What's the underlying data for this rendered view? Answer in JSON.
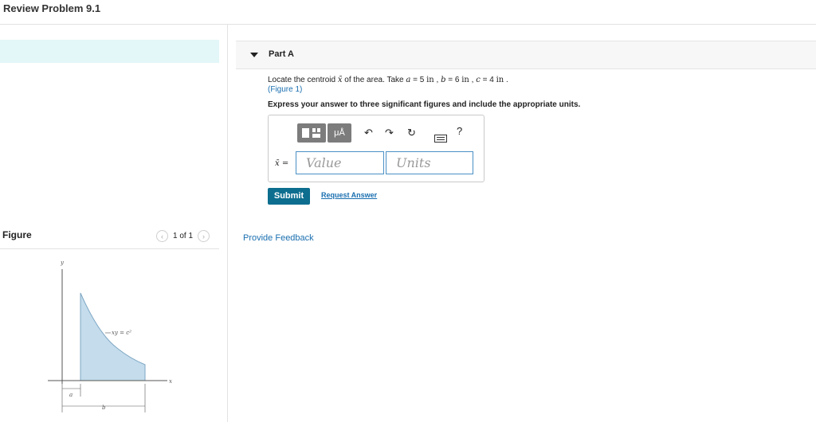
{
  "page": {
    "title": "Review Problem 9.1"
  },
  "part": {
    "label": "Part A"
  },
  "question": {
    "pre": "Locate the centroid ",
    "var": "x̄",
    "mid": " of the area. Take ",
    "a": "a",
    "a_val": " = 5 ",
    "b": "b",
    "b_val": " = 6 ",
    "c": "c",
    "c_val": " = 4 ",
    "unit": "in",
    "sep": " , ",
    "end": " .",
    "figure_link": "(Figure 1)",
    "express": "Express your answer to three significant figures and include the appropriate units."
  },
  "toolbar": {
    "mu_label": "μÅ",
    "undo_icon": "undo-icon",
    "redo_icon": "redo-icon",
    "reset_icon": "reset-icon",
    "keyboard_icon": "keyboard-icon",
    "help_label": "?"
  },
  "answer": {
    "var_label": "x̄ =",
    "value_placeholder": "Value",
    "units_placeholder": "Units"
  },
  "actions": {
    "submit_label": "Submit",
    "request_label": "Request Answer",
    "feedback_label": "Provide Feedback"
  },
  "figure": {
    "title": "Figure",
    "pager": "1 of 1",
    "prev_icon": "chevron-left-icon",
    "next_icon": "chevron-right-icon",
    "axis_y": "y",
    "axis_x": "x",
    "curve_label": "xy = c²",
    "dim_a": "a",
    "dim_b": "b",
    "fill_color": "#c4dcec"
  }
}
